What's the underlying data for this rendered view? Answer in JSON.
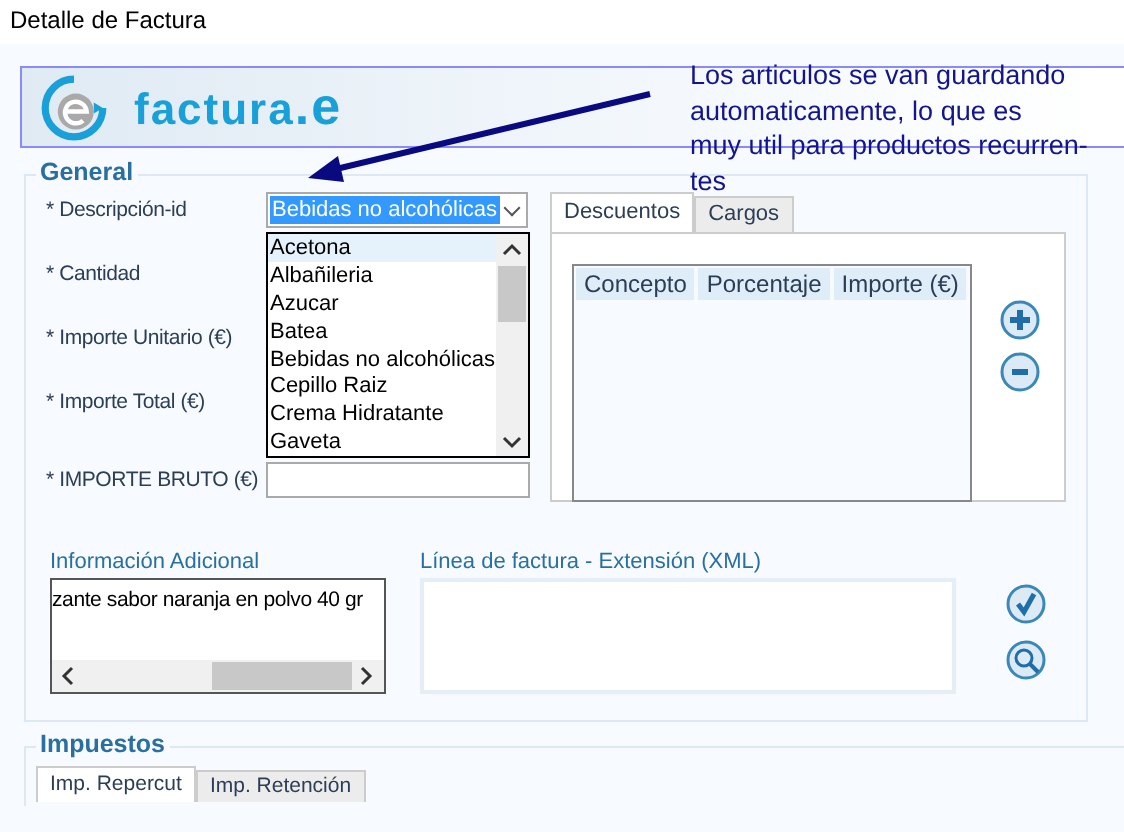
{
  "window": {
    "title": "Detalle de Factura"
  },
  "logo": {
    "text": "factura",
    "suffix": ".e"
  },
  "annotation": {
    "lines": [
      "Los articulos se van guardando",
      "automaticamente, lo que es",
      "muy util para productos recurren-",
      "tes"
    ]
  },
  "general": {
    "legend": "General",
    "fields": [
      {
        "label": "* Descripción-id",
        "kind": "select",
        "value": "Bebidas no alcohólicas"
      },
      {
        "label": "* Cantidad",
        "kind": "hidden"
      },
      {
        "label": "* Importe Unitario (€)",
        "kind": "hidden"
      },
      {
        "label": "* Importe Total (€)",
        "kind": "hidden"
      },
      {
        "label": "* IMPORTE BRUTO (€)",
        "kind": "input"
      }
    ],
    "dropdown": [
      {
        "label": "Acetona",
        "highlighted": true
      },
      {
        "label": "Albañileria",
        "highlighted": false
      },
      {
        "label": "Azucar",
        "highlighted": false
      },
      {
        "label": "Batea",
        "highlighted": false
      },
      {
        "label": "Bebidas no alcohólicas",
        "highlighted": false
      },
      {
        "label": "Cepillo Raiz",
        "highlighted": false
      },
      {
        "label": "Crema Hidratante",
        "highlighted": false
      },
      {
        "label": "Gaveta",
        "highlighted": false
      }
    ],
    "tabs": [
      {
        "label": "Descuentos",
        "selected": true
      },
      {
        "label": "Cargos",
        "selected": false
      }
    ],
    "table": {
      "columns": [
        "Concepto",
        "Porcentaje",
        "Importe (€)"
      ]
    },
    "info": {
      "label": "Información Adicional",
      "value": "zante sabor naranja en polvo 40 gr"
    },
    "xml": {
      "label": "Línea de factura - Extensión (XML)"
    }
  },
  "impuestos": {
    "legend": "Impuestos",
    "tabs": [
      {
        "label": "Imp. Repercut",
        "selected": true
      },
      {
        "label": "Imp. Retención",
        "selected": false
      }
    ]
  }
}
